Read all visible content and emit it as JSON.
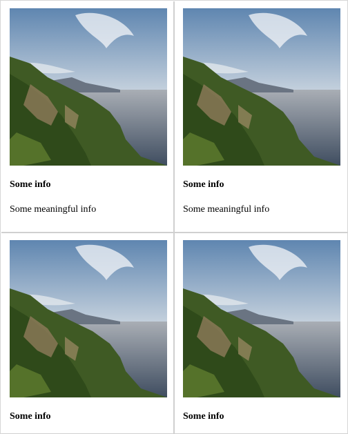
{
  "cards": [
    {
      "title": "Some info",
      "description": "Some meaningful info"
    },
    {
      "title": "Some info",
      "description": "Some meaningful info"
    },
    {
      "title": "Some info"
    },
    {
      "title": "Some info"
    }
  ],
  "image": {
    "subject": "coastal-landscape"
  }
}
